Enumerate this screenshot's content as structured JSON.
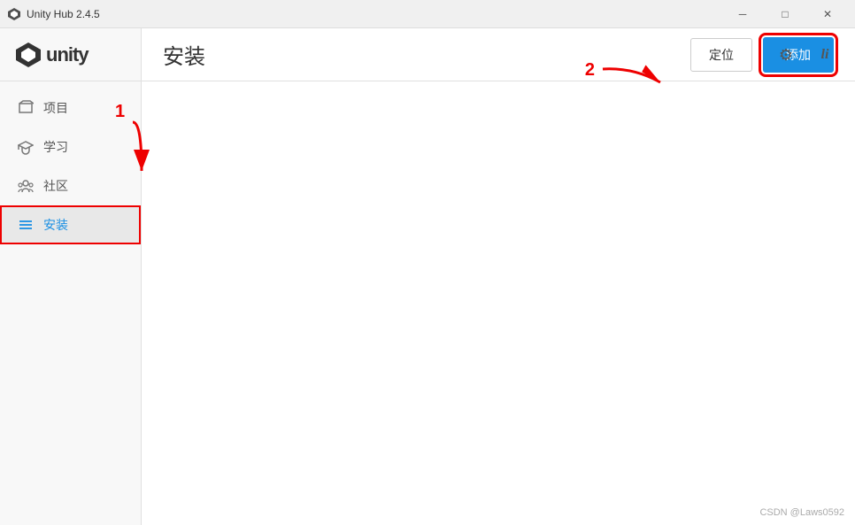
{
  "titleBar": {
    "title": "Unity Hub 2.4.5",
    "minimizeLabel": "─",
    "maximizeLabel": "□",
    "closeLabel": "✕"
  },
  "sidebar": {
    "logoText": "unity",
    "items": [
      {
        "id": "projects",
        "label": "项目",
        "icon": "◈",
        "active": false
      },
      {
        "id": "learn",
        "label": "学习",
        "icon": "🎓",
        "active": false
      },
      {
        "id": "community",
        "label": "社区",
        "icon": "👥",
        "active": false
      },
      {
        "id": "installs",
        "label": "安装",
        "icon": "≡",
        "active": true
      }
    ]
  },
  "header": {
    "pageTitle": "安装",
    "settingsIcon": "⚙",
    "profileIcon": "li",
    "locateButton": "定位",
    "addButton": "添加"
  },
  "watermark": "CSDN @Laws0592",
  "annotations": {
    "num1": "1",
    "num2": "2"
  }
}
